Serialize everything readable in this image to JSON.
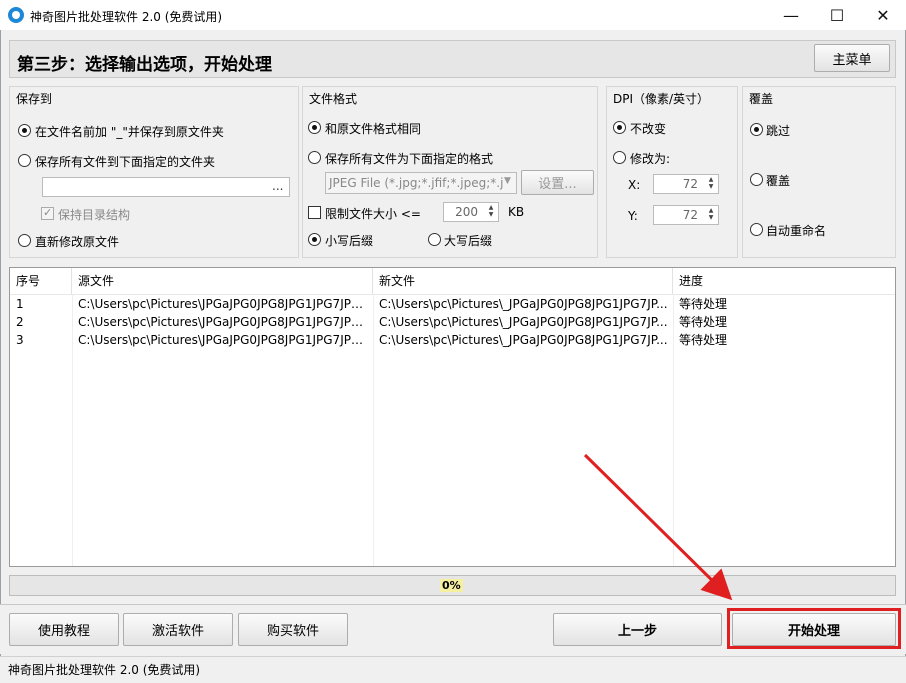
{
  "window": {
    "title": "神奇图片批处理软件 2.0 (免费试用)",
    "controls": {
      "minimize": "—",
      "maximize": "☐",
      "close": "✕"
    }
  },
  "header": {
    "title": "第三步：选择输出选项，开始处理",
    "main_menu_label": "主菜单"
  },
  "save_to": {
    "title": "保存到",
    "options": [
      {
        "label": "在文件名前加 \"_\"并保存到原文件夹",
        "selected": true
      },
      {
        "label": "保存所有文件到下面指定的文件夹",
        "selected": false
      },
      {
        "label": "直新修改原文件",
        "selected": false
      }
    ],
    "folder_value": "",
    "browse_label": "...",
    "keep_structure_label": "保持目录结构"
  },
  "file_format": {
    "title": "文件格式",
    "same_as_original_label": "和原文件格式相同",
    "save_as_format_label": "保存所有文件为下面指定的格式",
    "format_value": "JPEG File (*.jpg;*.jfif;*.jpeg;*.j",
    "settings_label": "设置...",
    "limit_size_label": "限制文件大小 <=",
    "limit_size_value": "200",
    "limit_size_unit": "KB",
    "lowercase_ext_label": "小写后缀",
    "uppercase_ext_label": "大写后缀"
  },
  "dpi": {
    "title": "DPI（像素/英寸）",
    "no_change_label": "不改变",
    "change_to_label": "修改为:",
    "x_label": "X:",
    "x_value": "72",
    "y_label": "Y:",
    "y_value": "72"
  },
  "overwrite": {
    "title": "覆盖",
    "skip_label": "跳过",
    "overwrite_label": "覆盖",
    "auto_rename_label": "自动重命名"
  },
  "table": {
    "columns": [
      "序号",
      "源文件",
      "新文件",
      "进度"
    ],
    "rows": [
      [
        "1",
        "C:\\Users\\pc\\Pictures\\JPGaJPG0JPG8JPG1JPG7JPGa...",
        "C:\\Users\\pc\\Pictures\\_JPGaJPG0JPG8JPG1JPG7JP...",
        "等待处理"
      ],
      [
        "2",
        "C:\\Users\\pc\\Pictures\\JPGaJPG0JPG8JPG1JPG7JPGa...",
        "C:\\Users\\pc\\Pictures\\_JPGaJPG0JPG8JPG1JPG7JP...",
        "等待处理"
      ],
      [
        "3",
        "C:\\Users\\pc\\Pictures\\JPGaJPG0JPG8JPG1JPG7JPGa...",
        "C:\\Users\\pc\\Pictures\\_JPGaJPG0JPG8JPG1JPG7JP...",
        "等待处理"
      ]
    ]
  },
  "progress": {
    "label": "0%",
    "fraction": 0
  },
  "bottom": {
    "tutorial_label": "使用教程",
    "activate_label": "激活软件",
    "buy_label": "购买软件",
    "prev_label": "上一步",
    "start_label": "开始处理"
  },
  "status": {
    "text": "神奇图片批处理软件 2.0 (免费试用)"
  },
  "colors": {
    "accent_red": "#e02020",
    "icon_blue": "#1e88d8"
  }
}
